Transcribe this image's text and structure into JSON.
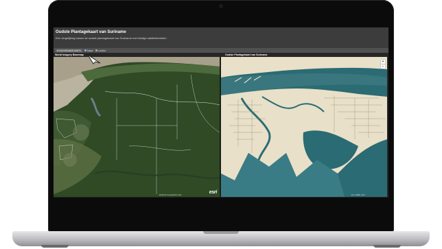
{
  "app": {
    "title": "Oudste Plantagekaart van Suriname",
    "subtitle": "Een vergelijking tussen de oudste plantagekaart van Suriname met huidige satellietbeelden"
  },
  "toolbar": {
    "sync_label": "SYNCHRONIZE MAPS",
    "swipe_label": "Swipe",
    "locator_label": "Locator"
  },
  "panels": {
    "left_title": "World Imagery Basemap",
    "right_title": "Oudste Plantagekaart van Suriname",
    "left_attribution": "Earthstar Geographics | Esri",
    "right_attribution": "Esri, HERE | Esri",
    "logo_text": "esri"
  },
  "zoom": {
    "in": "+",
    "out": "−"
  },
  "colors": {
    "header_bg": "#3c3c3c",
    "toolbar_bg": "#505050",
    "sea": "#a8a08a",
    "forest": "#2f4a25",
    "map_sea": "#2b6b73",
    "map_land": "#e8e0c8"
  },
  "icons": [
    "swipe-icon",
    "locator-icon",
    "cursor-arrow-icon",
    "zoom-in-icon",
    "zoom-out-icon"
  ]
}
